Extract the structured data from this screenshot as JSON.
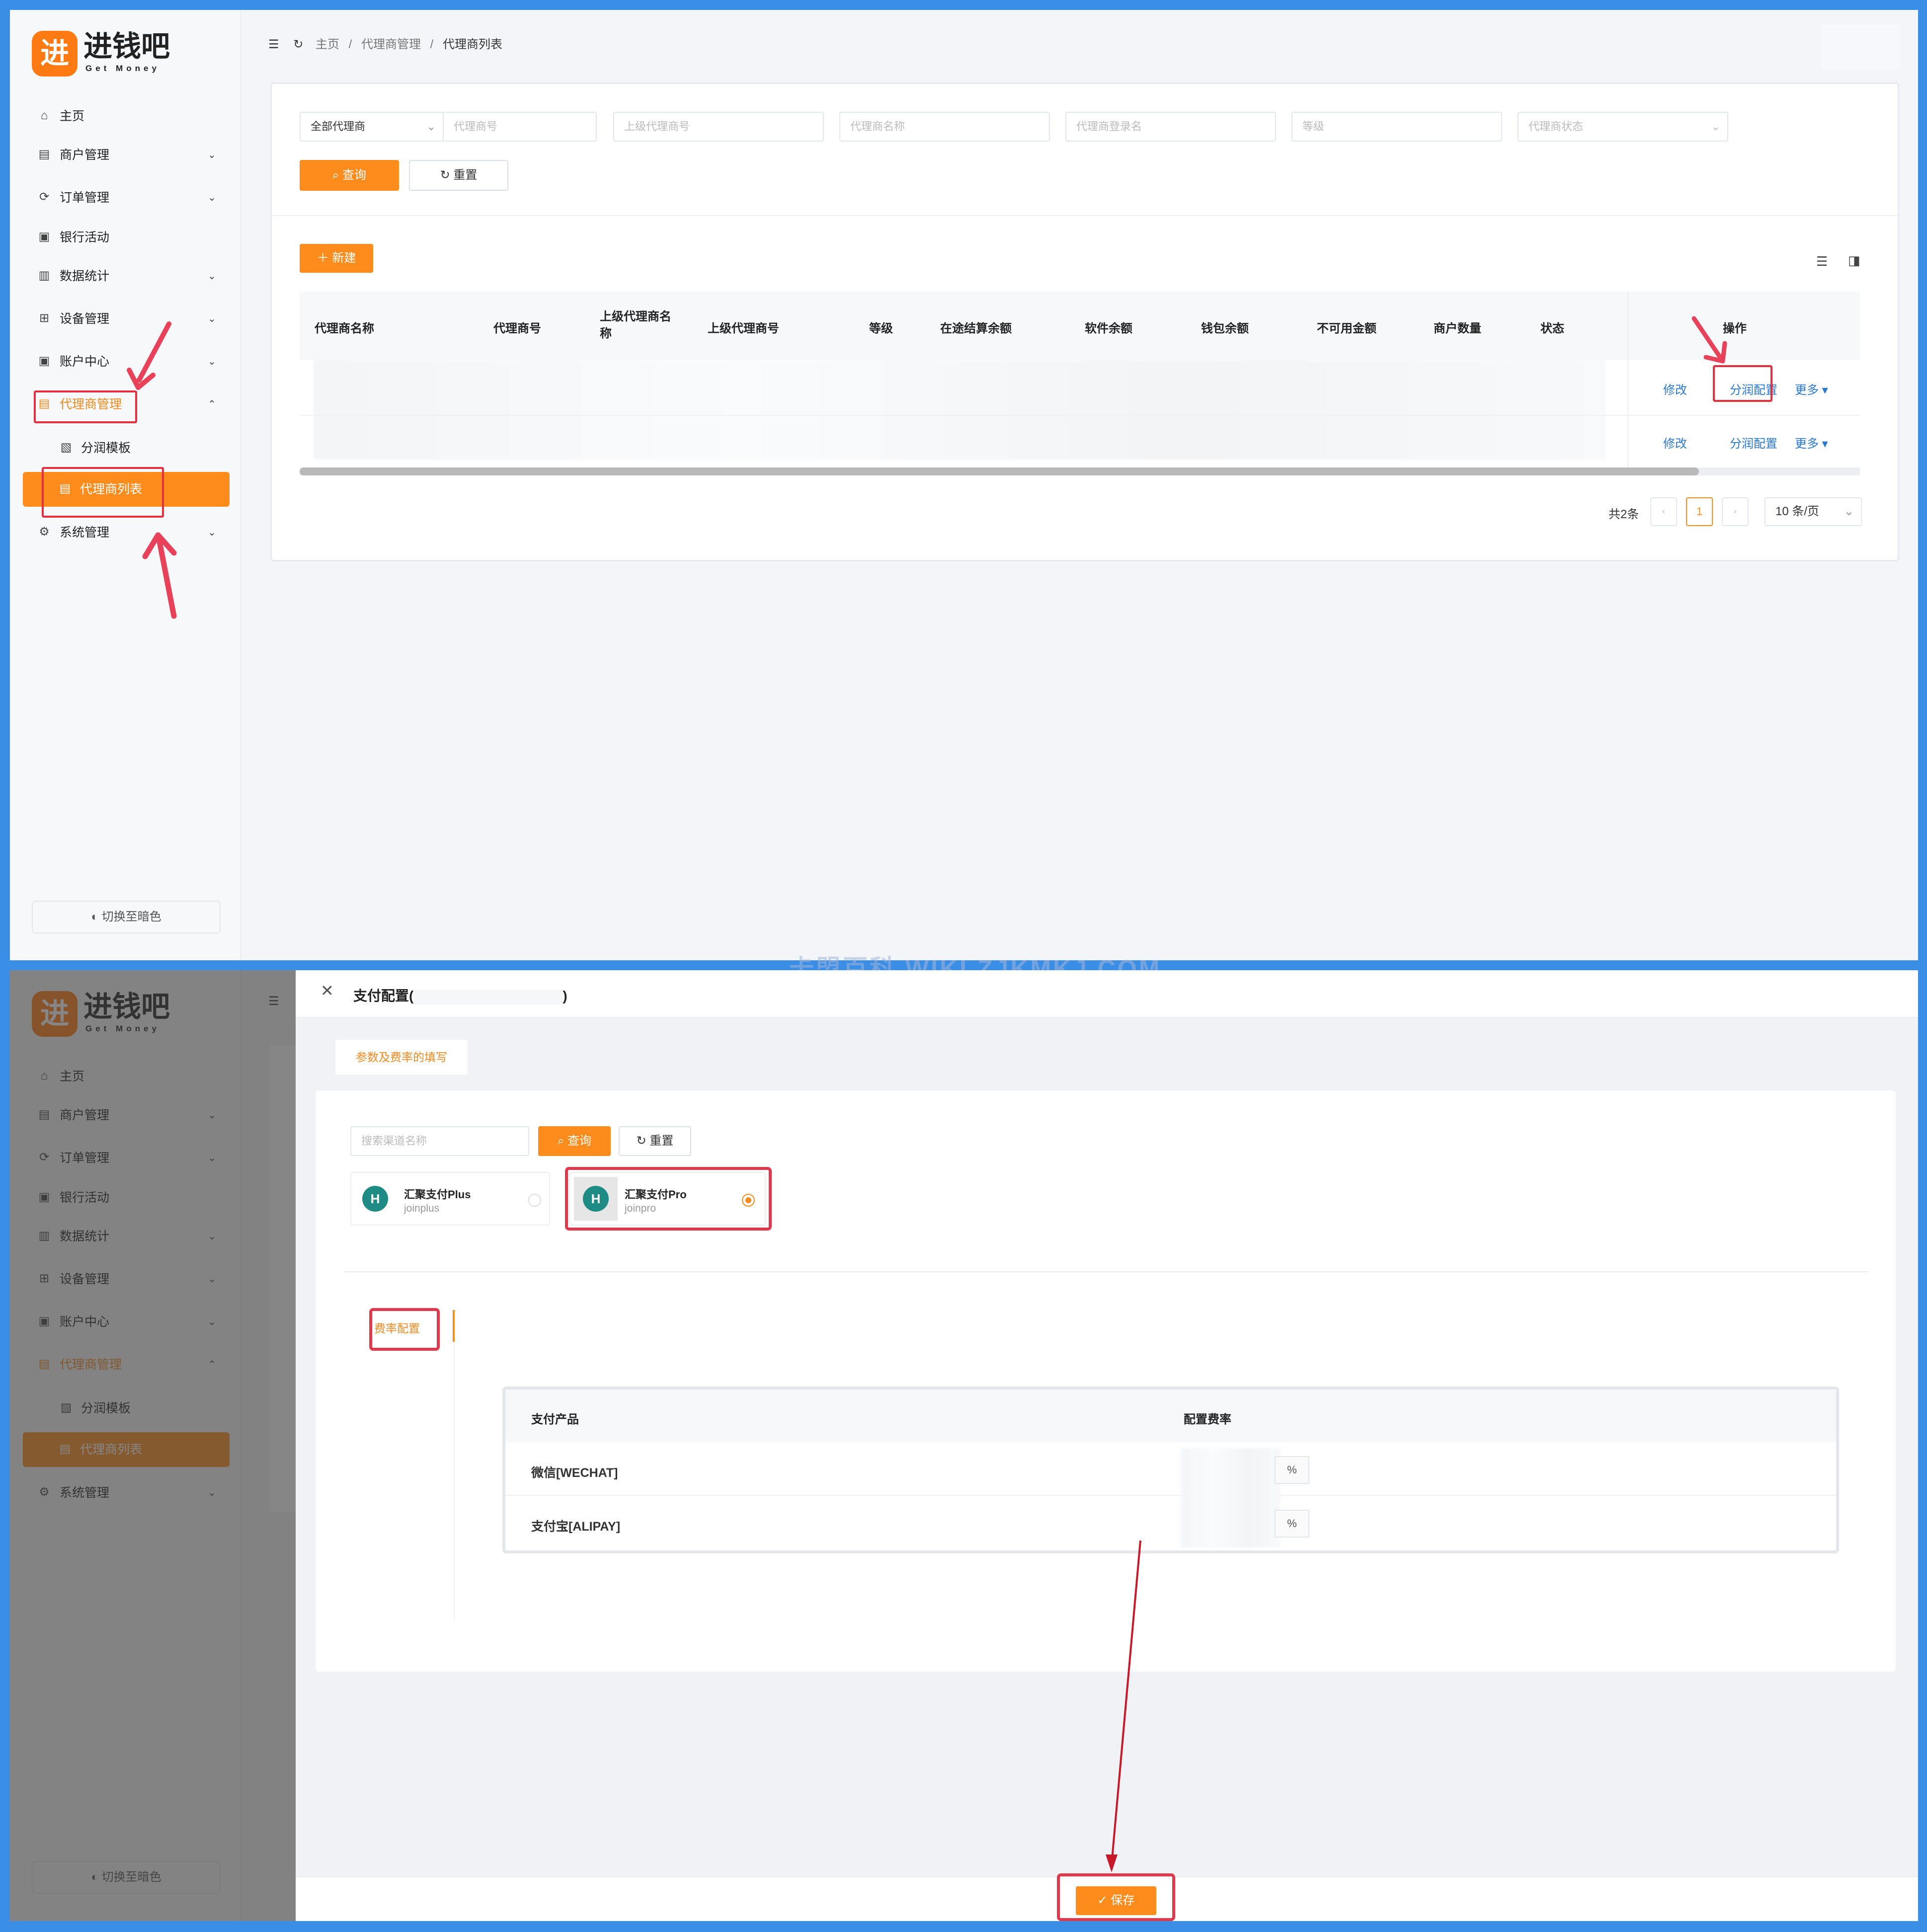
{
  "brand": {
    "logo_char": "进",
    "name_cn": "进钱吧",
    "name_en": "Get Money"
  },
  "sidebar": {
    "items": [
      {
        "label": "主页",
        "icon": "home-icon",
        "glyph": "⌂"
      },
      {
        "label": "商户管理",
        "icon": "store-icon",
        "glyph": "▤"
      },
      {
        "label": "订单管理",
        "icon": "order-icon",
        "glyph": "⟳"
      },
      {
        "label": "银行活动",
        "icon": "bank-icon",
        "glyph": "▣"
      },
      {
        "label": "数据统计",
        "icon": "chart-icon",
        "glyph": "▥"
      },
      {
        "label": "设备管理",
        "icon": "device-icon",
        "glyph": "⊞"
      },
      {
        "label": "账户中心",
        "icon": "wallet-icon",
        "glyph": "▣"
      },
      {
        "label": "代理商管理",
        "icon": "agent-icon",
        "glyph": "▤"
      },
      {
        "label": "分润模板",
        "icon": "template-icon",
        "glyph": "▧"
      },
      {
        "label": "代理商列表",
        "icon": "list-icon",
        "glyph": "▤"
      },
      {
        "label": "系统管理",
        "icon": "gear-icon",
        "glyph": "⚙"
      }
    ],
    "dark_mode_label": "切换至暗色"
  },
  "breadcrumb": {
    "home": "主页",
    "section": "代理商管理",
    "page": "代理商列表",
    "sep": "/"
  },
  "filters": {
    "agent_scope": "全部代理商",
    "agent_no": "代理商号",
    "parent_agent_no": "上级代理商号",
    "agent_name": "代理商名称",
    "login_name": "代理商登录名",
    "level": "等级",
    "status": "代理商状态",
    "query": "查询",
    "reset": "重置"
  },
  "toolbar": {
    "new": "新建"
  },
  "table": {
    "headers": [
      "代理商名称",
      "代理商号",
      "上级代理商名称",
      "上级代理商号",
      "等级",
      "在途结算余额",
      "软件余额",
      "钱包余额",
      "不可用金额",
      "商户数量",
      "状态",
      "操作"
    ],
    "row_actions": {
      "edit": "修改",
      "profit": "分润配置",
      "more": "更多"
    }
  },
  "pagination": {
    "total": "共2条",
    "page": "1",
    "page_size": "10 条/页"
  },
  "watermark": "卡盟百科 WIKI.ZJKMKJ.COM",
  "drawer": {
    "title_prefix": "支付配置(",
    "title_suffix": ")",
    "tab": "参数及费率的填写",
    "search_placeholder": "搜索渠道名称",
    "query": "查询",
    "reset": "重置",
    "channels": [
      {
        "name": "汇聚支付Plus",
        "code": "joinplus",
        "selected": false
      },
      {
        "name": "汇聚支付Pro",
        "code": "joinpro",
        "selected": true
      }
    ],
    "side_tab": "费率配置",
    "rate_table": {
      "headers": [
        "支付产品",
        "配置费率"
      ],
      "rows": [
        {
          "product": "微信[WECHAT]",
          "unit": "%"
        },
        {
          "product": "支付宝[ALIPAY]",
          "unit": "%"
        }
      ]
    },
    "save": "保存"
  },
  "colors": {
    "accent": "#fd8c1c",
    "link": "#2b78d0",
    "highlight": "#e23040",
    "frame": "#3a8ee6"
  }
}
